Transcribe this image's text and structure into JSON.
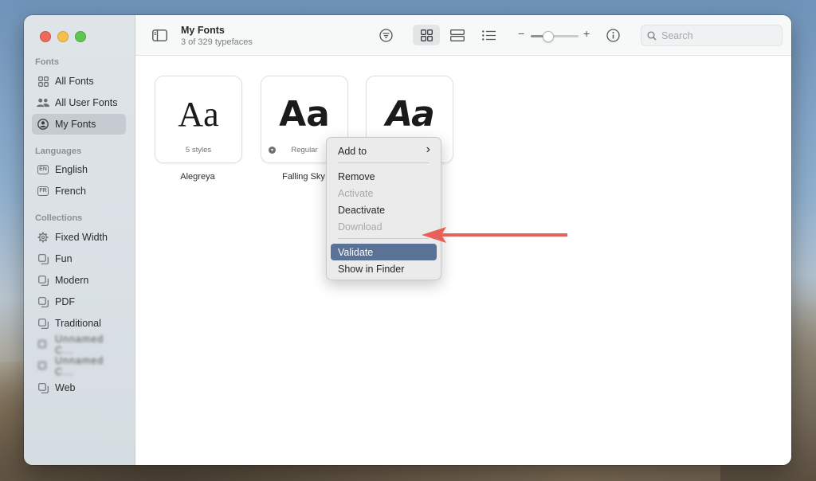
{
  "window": {
    "title": "My Fonts",
    "subtitle": "3 of 329 typefaces"
  },
  "sidebar": {
    "sections": {
      "fonts": "Fonts",
      "languages": "Languages",
      "collections": "Collections"
    },
    "fonts_items": [
      {
        "label": "All Fonts",
        "icon": "grid-icon"
      },
      {
        "label": "All User Fonts",
        "icon": "users-icon"
      },
      {
        "label": "My Fonts",
        "icon": "person-circle-icon",
        "active": true
      }
    ],
    "language_items": [
      {
        "label": "English",
        "badge": "EN"
      },
      {
        "label": "French",
        "badge": "FR"
      }
    ],
    "collection_items": [
      {
        "label": "Fixed Width",
        "icon": "gear-icon"
      },
      {
        "label": "Fun",
        "icon": "collection-icon"
      },
      {
        "label": "Modern",
        "icon": "collection-icon"
      },
      {
        "label": "PDF",
        "icon": "collection-icon"
      },
      {
        "label": "Traditional",
        "icon": "collection-icon"
      },
      {
        "label": "Unnamed C...",
        "icon": "collection-icon",
        "blurred": true
      },
      {
        "label": "Unnamed C...",
        "icon": "collection-icon",
        "blurred": true
      },
      {
        "label": "Web",
        "icon": "collection-icon"
      }
    ]
  },
  "toolbar": {
    "search_placeholder": "Search",
    "zoom_minus": "−",
    "zoom_plus": "+",
    "zoom_level": 0.35
  },
  "fonts": [
    {
      "name": "Alegreya",
      "sample": "Aa",
      "style_label": "5 styles"
    },
    {
      "name": "Falling Sky",
      "sample": "Aa",
      "style_label": "Regular",
      "has_download": true
    },
    {
      "name": "",
      "sample": "Aa",
      "style_label": ""
    }
  ],
  "context_menu": {
    "items": [
      {
        "label": "Add to",
        "submenu": true,
        "submenu_glyph": "›"
      },
      {
        "label": "Remove"
      },
      {
        "label": "Activate",
        "disabled": true
      },
      {
        "label": "Deactivate"
      },
      {
        "label": "Download",
        "disabled": true
      },
      {
        "label": "Validate",
        "highlighted": true
      },
      {
        "label": "Show in Finder"
      }
    ]
  },
  "colors": {
    "highlight": "#5a7296",
    "arrow": "#e8605a"
  }
}
